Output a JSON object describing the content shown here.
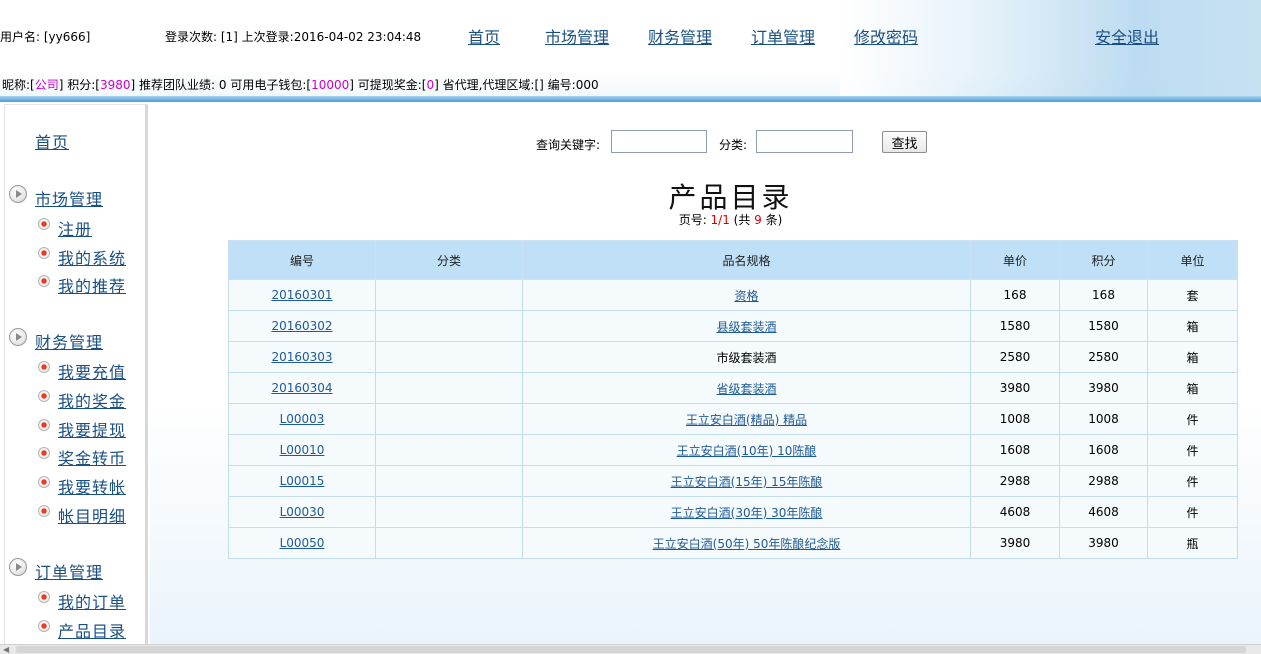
{
  "header": {
    "user_label": "用户名: [yy666]",
    "login_info": "登录次数: [1]   上次登录:2016-04-02 23:04:48",
    "nav": [
      "首页",
      "市场管理",
      "财务管理",
      "订单管理",
      "修改密码"
    ],
    "logout": "安全退出",
    "row2": {
      "nickname_label": "昵称:[",
      "nickname": "公司",
      "points_label": "]  积分:[",
      "points": "3980",
      "team_label": "]  推荐团队业绩: 0  可用电子钱包:[",
      "wallet": "10000",
      "bonus_label": "]  可提现奖金:[",
      "bonus": "0",
      "tail": "]  省代理,代理区域:[]  编号:000"
    }
  },
  "sidebar": {
    "home": "首页",
    "groups": [
      {
        "title": "市场管理",
        "items": [
          "注册",
          "我的系统",
          "我的推荐"
        ]
      },
      {
        "title": "财务管理",
        "items": [
          "我要充值",
          "我的奖金",
          "我要提现",
          "奖金转币",
          "我要转帐",
          "帐目明细"
        ]
      },
      {
        "title": "订单管理",
        "items": [
          "我的订单",
          "产品目录"
        ]
      }
    ]
  },
  "search": {
    "keyword_label": "查询关键字:",
    "category_label": "分类:",
    "keyword_value": "",
    "category_value": "",
    "button": "查找"
  },
  "page": {
    "title": "产品目录",
    "info_prefix": "页号: ",
    "page_num": "1/1",
    "info_mid": " (共 ",
    "total": "9",
    "info_suffix": " 条)"
  },
  "table": {
    "columns": [
      "编号",
      "分类",
      "品名规格",
      "单价",
      "积分",
      "单位"
    ],
    "rows": [
      {
        "code": "20160301",
        "category": "",
        "name": "资格",
        "name_link": true,
        "price": "168",
        "points": "168",
        "unit": "套"
      },
      {
        "code": "20160302",
        "category": "",
        "name": "县级套装酒",
        "name_link": true,
        "price": "1580",
        "points": "1580",
        "unit": "箱"
      },
      {
        "code": "20160303",
        "category": "",
        "name": "市级套装酒",
        "name_link": false,
        "price": "2580",
        "points": "2580",
        "unit": "箱"
      },
      {
        "code": "20160304",
        "category": "",
        "name": "省级套装酒",
        "name_link": true,
        "price": "3980",
        "points": "3980",
        "unit": "箱"
      },
      {
        "code": "L00003",
        "category": "",
        "name": "王立安白酒(精品) 精品",
        "name_link": true,
        "price": "1008",
        "points": "1008",
        "unit": "件"
      },
      {
        "code": "L00010",
        "category": "",
        "name": "王立安白酒(10年) 10陈酿",
        "name_link": true,
        "price": "1608",
        "points": "1608",
        "unit": "件"
      },
      {
        "code": "L00015",
        "category": "",
        "name": "王立安白酒(15年) 15年陈酿",
        "name_link": true,
        "price": "2988",
        "points": "2988",
        "unit": "件"
      },
      {
        "code": "L00030",
        "category": "",
        "name": "王立安白酒(30年) 30年陈酿",
        "name_link": true,
        "price": "4608",
        "points": "4608",
        "unit": "件"
      },
      {
        "code": "L00050",
        "category": "",
        "name": "王立安白酒(50年) 50年陈酿纪念版",
        "name_link": true,
        "price": "3980",
        "points": "3980",
        "unit": "瓶"
      }
    ]
  },
  "colors": {
    "link": "#1a4f86",
    "accent_magenta": "#cc00cc",
    "accent_red": "#e00000",
    "table_header": "#bfe0f7",
    "header_band": "#6fb3e0"
  },
  "icons": {
    "group": "play-circle-icon",
    "item": "red-dot-bullet-icon",
    "scroll_left": "scroll-left-arrow-icon"
  }
}
